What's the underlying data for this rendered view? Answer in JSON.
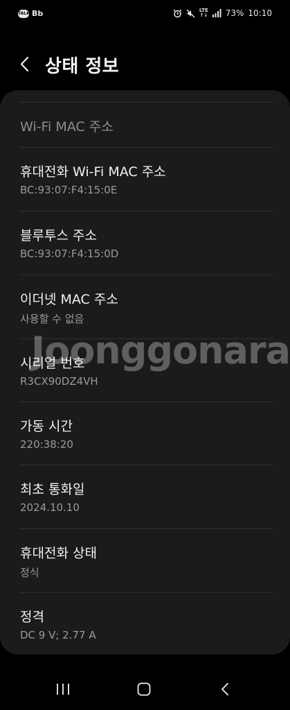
{
  "status_bar": {
    "app_icon_1": "TALK",
    "app_icon_2": "Bb",
    "network": "LTE",
    "battery": "73%",
    "time": "10:10"
  },
  "header": {
    "title": "상태 정보"
  },
  "items": [
    {
      "title": "Wi-Fi MAC 주소",
      "subtitle": ""
    },
    {
      "title": "휴대전화 Wi-Fi MAC 주소",
      "subtitle": "BC:93:07:F4:15:0E"
    },
    {
      "title": "블루투스 주소",
      "subtitle": "BC:93:07:F4:15:0D"
    },
    {
      "title": "이더넷 MAC 주소",
      "subtitle": "사용할 수 없음"
    },
    {
      "title": "시리얼 번호",
      "subtitle": "R3CX90DZ4VH"
    },
    {
      "title": "가동 시간",
      "subtitle": "220:38:20"
    },
    {
      "title": "최초 통화일",
      "subtitle": "2024.10.10"
    },
    {
      "title": "휴대전화 상태",
      "subtitle": "정식"
    },
    {
      "title": "정격",
      "subtitle": "DC 9 V; 2.77 A"
    }
  ],
  "watermark": "Joonggonara",
  "colors": {
    "background": "#000000",
    "card": "#1b1b1d",
    "divider": "#303032",
    "title_text": "#f2f2f2",
    "subtitle_text": "#9a9a9c"
  }
}
